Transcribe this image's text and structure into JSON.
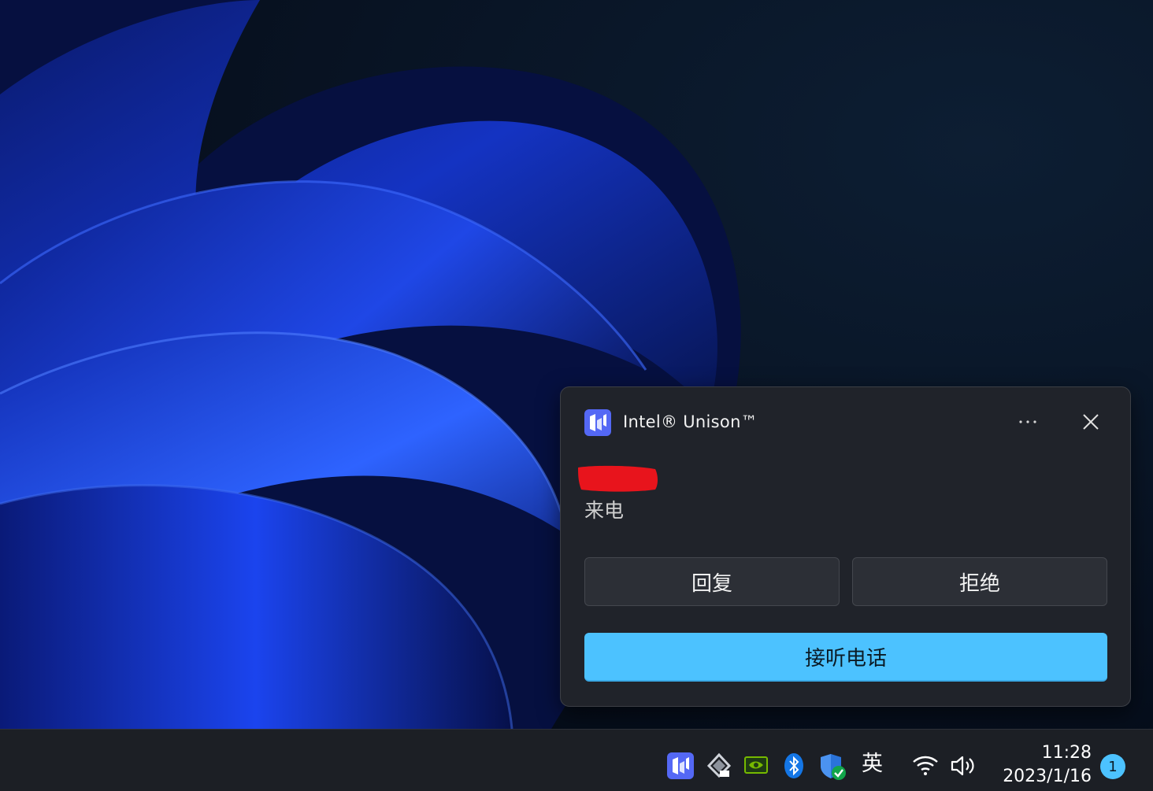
{
  "notification": {
    "app_name": "Intel® Unison™",
    "subtitle": "来电",
    "buttons": {
      "reply": "回复",
      "decline": "拒绝",
      "answer": "接听电话"
    },
    "accent_color": "#4cc2ff"
  },
  "taskbar": {
    "tray_icons": [
      "intel-unison-icon",
      "network-drive-icon",
      "nvidia-icon",
      "bluetooth-icon",
      "windows-security-icon",
      "wifi-icon",
      "volume-icon"
    ],
    "ime_label": "英",
    "time": "11:28",
    "date": "2023/1/16",
    "notification_count": "1"
  }
}
